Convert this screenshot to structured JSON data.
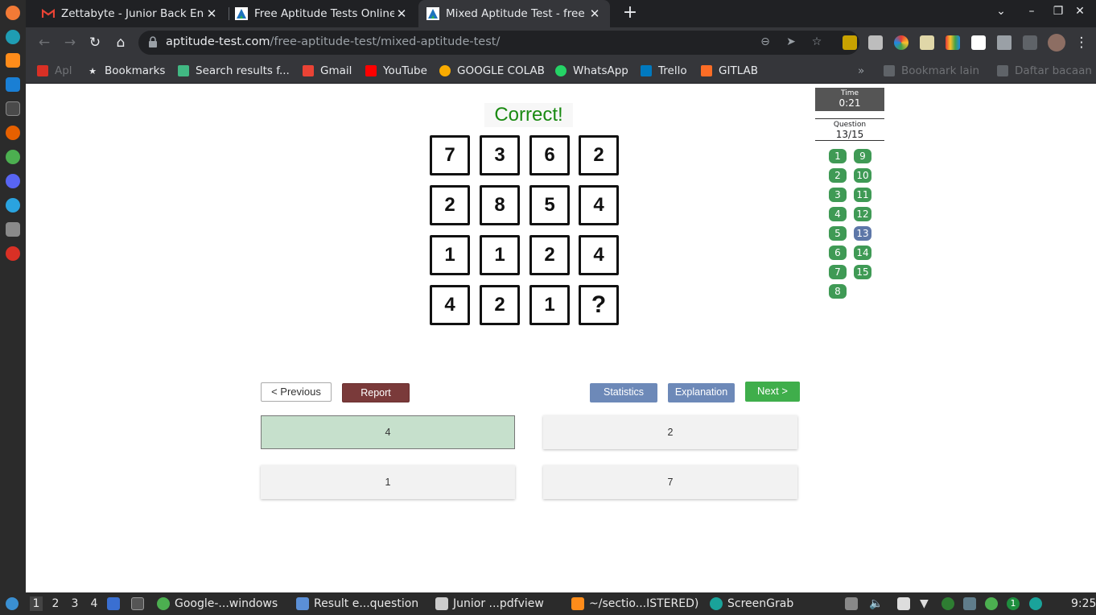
{
  "browser": {
    "tabs": [
      {
        "title": "Zettabyte - Junior Back End",
        "close": "✕",
        "favicon": "gmail-icon",
        "active": false
      },
      {
        "title": "Free Aptitude Tests Online",
        "close": "✕",
        "favicon": "aptitude-icon",
        "active": false
      },
      {
        "title": "Mixed Aptitude Test - free a",
        "close": "✕",
        "favicon": "aptitude-icon",
        "active": true
      }
    ],
    "new_tab": "+",
    "url_domain": "aptitude-test.com",
    "url_path": "/free-aptitude-test/mixed-aptitude-test/",
    "bookmarks": [
      {
        "label": "Apl",
        "icon": "apps-grid-icon"
      },
      {
        "label": "Bookmarks",
        "icon": "star-icon"
      },
      {
        "label": "Search results f...",
        "icon": "vue-icon"
      },
      {
        "label": "Gmail",
        "icon": "gmail-icon"
      },
      {
        "label": "YouTube",
        "icon": "youtube-icon"
      },
      {
        "label": "GOOGLE COLAB",
        "icon": "colab-icon"
      },
      {
        "label": "WhatsApp",
        "icon": "whatsapp-icon"
      },
      {
        "label": "Trello",
        "icon": "trello-icon"
      },
      {
        "label": "GITLAB",
        "icon": "gitlab-icon"
      }
    ],
    "bookmarks_more": "»",
    "other_bookmarks": "Bookmark lain",
    "reading_list": "Daftar bacaan"
  },
  "quiz": {
    "result": "Correct!",
    "grid": [
      [
        "7",
        "3",
        "6",
        "2"
      ],
      [
        "2",
        "8",
        "5",
        "4"
      ],
      [
        "1",
        "1",
        "2",
        "4"
      ],
      [
        "4",
        "2",
        "1",
        "?"
      ]
    ],
    "time_label": "Time",
    "time_value": "0:21",
    "question_label": "Question",
    "question_value": "13/15",
    "question_numbers": [
      "1",
      "2",
      "3",
      "4",
      "5",
      "6",
      "7",
      "8",
      "9",
      "10",
      "11",
      "12",
      "13",
      "14",
      "15"
    ],
    "current_question": "13",
    "buttons": {
      "previous": "<  Previous",
      "report": "Report",
      "statistics": "Statistics",
      "explanation": "Explanation",
      "next": "Next  >"
    },
    "answers": [
      "4",
      "2",
      "1",
      "7"
    ],
    "selected_answer": "4"
  },
  "taskbar": {
    "workspaces": [
      "1",
      "2",
      "3",
      "4"
    ],
    "items": [
      {
        "label": "Google-...windows",
        "icon": "chrome-icon"
      },
      {
        "label": "Result e...question",
        "icon": "folder-icon"
      },
      {
        "label": "Junior ...pdfview",
        "icon": "pdf-viewer-icon"
      },
      {
        "label": "~/sectio...ISTERED)",
        "icon": "sublime-icon"
      },
      {
        "label": "ScreenGrab",
        "icon": "screengrab-icon"
      }
    ],
    "badge": "1",
    "clock": "9:25"
  },
  "colors": {
    "correct": "#1a8a12",
    "answered": "#3f9a55",
    "current": "#5d77a8",
    "report": "#7a3a3a",
    "next": "#3fae4b",
    "selected_answer_bg": "#c6e0cc"
  }
}
